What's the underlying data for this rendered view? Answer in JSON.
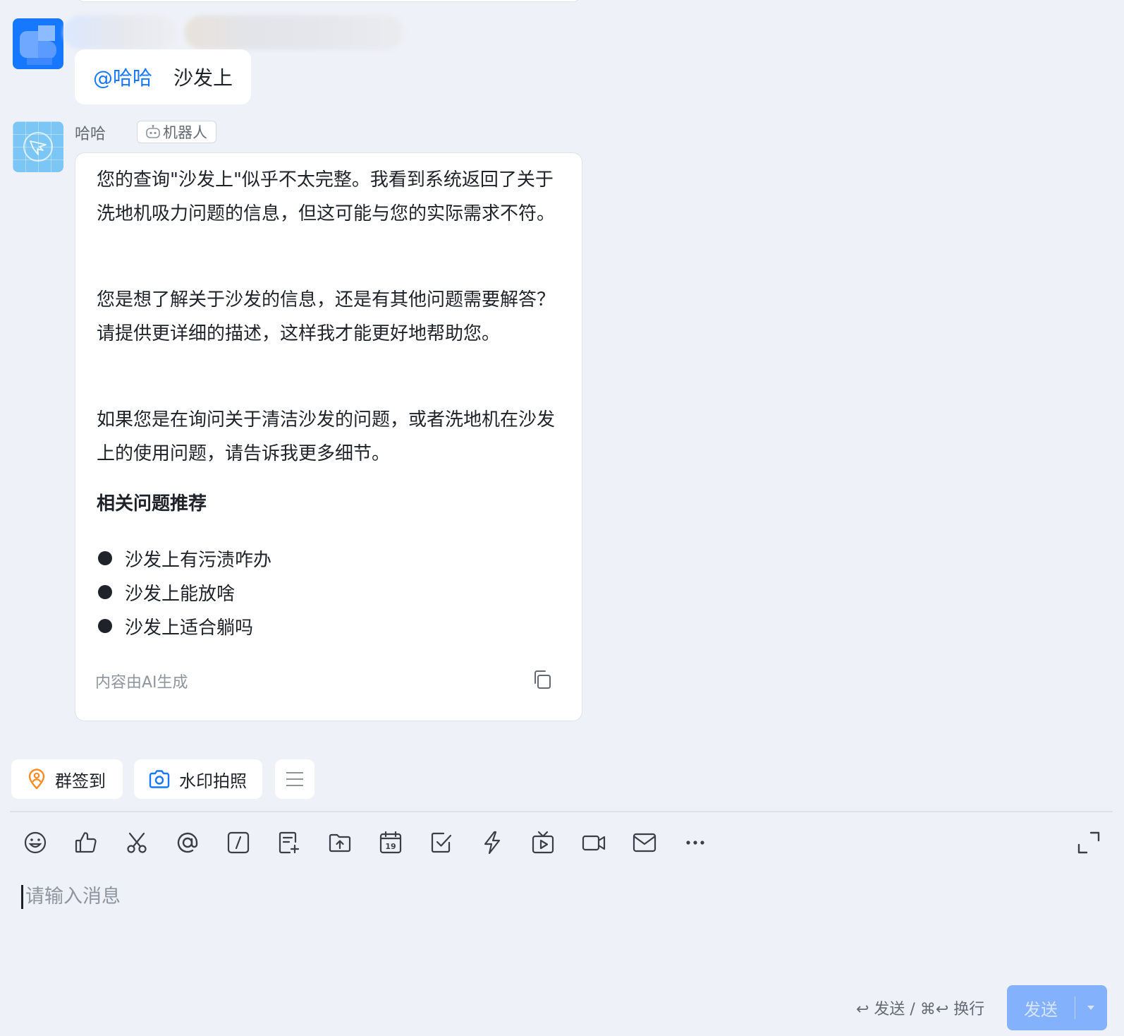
{
  "user_message": {
    "mention": "@哈哈",
    "text": "沙发上"
  },
  "bot_message": {
    "sender_name": "哈哈",
    "badge": "机器人",
    "paragraphs": [
      "您的查询\"沙发上\"似乎不太完整。我看到系统返回了关于洗地机吸力问题的信息，但这可能与您的实际需求不符。",
      "您是想了解关于沙发的信息，还是有其他问题需要解答？请提供更详细的描述，这样我才能更好地帮助您。",
      "如果您是在询问关于清洁沙发的问题，或者洗地机在沙发上的使用问题，请告诉我更多细节。"
    ],
    "related_title": "相关问题推荐",
    "related_questions": [
      "沙发上有污渍咋办",
      "沙发上能放啥",
      "沙发上适合躺吗"
    ],
    "ai_note": "内容由AI生成"
  },
  "quick_actions": {
    "checkin": "群签到",
    "photo": "水印拍照"
  },
  "toolbar_icons": [
    "emoji-icon",
    "thumbs-up-icon",
    "scissors-icon",
    "at-icon",
    "slash-command-icon",
    "new-doc-icon",
    "upload-folder-icon",
    "calendar-icon",
    "todo-check-icon",
    "lightning-icon",
    "live-tv-icon",
    "video-call-icon",
    "mail-icon",
    "more-icon"
  ],
  "calendar_day": "19",
  "input": {
    "placeholder": "请输入消息"
  },
  "send_hint": "↩ 发送 / ⌘↩ 换行",
  "send_button": "发送",
  "colors": {
    "accent": "#1677ff",
    "background": "#eef1f7",
    "send_disabled": "#84b1fb",
    "checkin_icon": "#ff8a1f"
  }
}
